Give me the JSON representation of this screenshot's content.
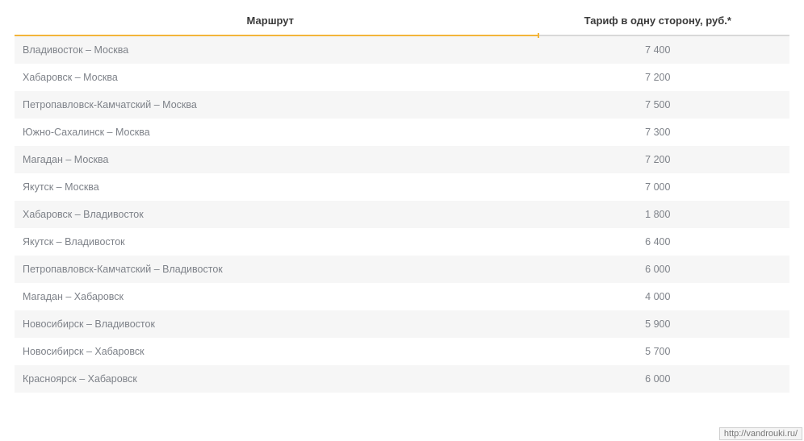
{
  "table": {
    "headers": {
      "route": "Маршрут",
      "price": "Тариф в одну сторону, руб.*"
    },
    "rows": [
      {
        "route": "Владивосток – Москва",
        "price": "7 400"
      },
      {
        "route": "Хабаровск – Москва",
        "price": "7 200"
      },
      {
        "route": "Петропавловск-Камчатский – Москва",
        "price": "7 500"
      },
      {
        "route": "Южно-Сахалинск – Москва",
        "price": "7 300"
      },
      {
        "route": "Магадан – Москва",
        "price": "7 200"
      },
      {
        "route": "Якутск – Москва",
        "price": "7 000"
      },
      {
        "route": "Хабаровск – Владивосток",
        "price": "1 800"
      },
      {
        "route": "Якутск – Владивосток",
        "price": "6 400"
      },
      {
        "route": "Петропавловск-Камчатский – Владивосток",
        "price": "6 000"
      },
      {
        "route": "Магадан – Хабаровск",
        "price": "4 000"
      },
      {
        "route": "Новосибирск – Владивосток",
        "price": "5 900"
      },
      {
        "route": "Новосибирск – Хабаровск",
        "price": "5 700"
      },
      {
        "route": "Красноярск – Хабаровск",
        "price": "6 000"
      }
    ]
  },
  "watermark": "http://vandrouki.ru/"
}
